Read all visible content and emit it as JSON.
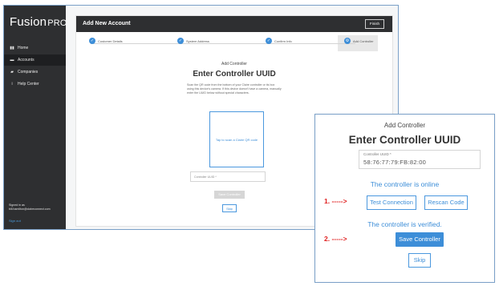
{
  "app": {
    "logo_main": "Fusion",
    "logo_pro": "PRO",
    "nav": [
      {
        "label": "Home",
        "icon": "bar-chart-icon",
        "glyph": "▮▮",
        "active": false
      },
      {
        "label": "Accounts",
        "icon": "folder-icon",
        "glyph": "▬",
        "active": true
      },
      {
        "label": "Companies",
        "icon": "building-icon",
        "glyph": "▰",
        "active": false
      },
      {
        "label": "Help Center",
        "icon": "info-icon",
        "glyph": "i",
        "active": false
      }
    ],
    "signed_in_label": "Signed in as",
    "signed_in_user": "bill.hamilton@claireconnect.com",
    "sign_out": "Sign out"
  },
  "panel": {
    "title": "Add New Account",
    "finish_label": "Finish",
    "steps": [
      {
        "label": "Customer Details"
      },
      {
        "label": "System Address"
      },
      {
        "label": "Confirm Info"
      },
      {
        "label": "Add Controller"
      }
    ],
    "subtitle": "Add Controller",
    "title_main": "Enter Controller UUID",
    "instructions": "Scan the QR code from the bottom of your Claire controller or its box using this device's camera. If this device doesn't have a camera, manually enter the UUID below without special characters.",
    "scan_prompt": "Tap to scan a Claire QR code",
    "uuid_placeholder": "Controller UUID *",
    "save_label": "Save Controller",
    "skip_label": "Skip"
  },
  "callout": {
    "subtitle": "Add Controller",
    "title": "Enter Controller UUID",
    "uuid_label": "Controller UUID *",
    "uuid_value": "58:76:77:79:FB:82:00",
    "online_status": "The controller is online",
    "test_label": "Test Connection",
    "rescan_label": "Rescan Code",
    "verified_status": "The controller is verified.",
    "save_label": "Save Controller",
    "skip_label": "Skip",
    "annotation_1": "1. ----->",
    "annotation_2": "2. ----->"
  },
  "colors": {
    "accent": "#3d8ed8",
    "sidebar": "#2e2f31",
    "annotation": "#e02020"
  }
}
